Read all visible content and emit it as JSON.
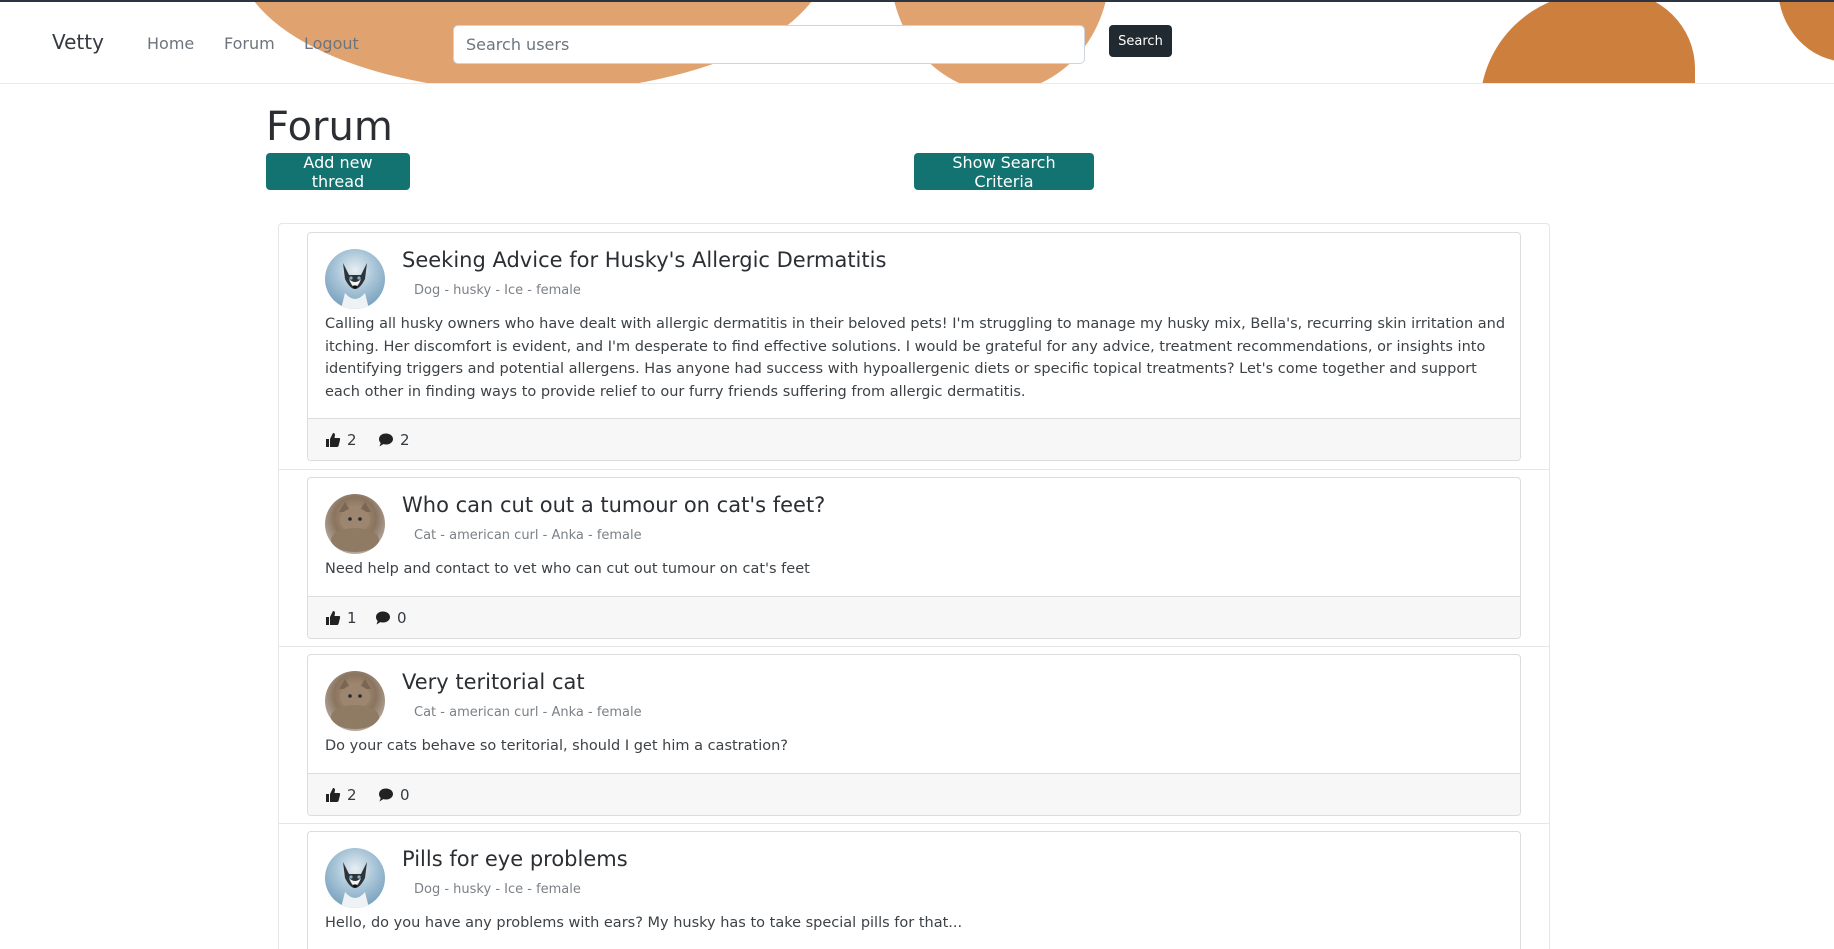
{
  "nav": {
    "brand": "Vetty",
    "home": "Home",
    "forum": "Forum",
    "logout": "Logout",
    "search_placeholder": "Search users",
    "search_button": "Search"
  },
  "page": {
    "title": "Forum",
    "add_thread_button": "Add new thread",
    "show_criteria_button": "Show Search Criteria"
  },
  "threads": [
    {
      "title": "Seeking Advice for Husky's Allergic Dermatitis",
      "pet_info": "Dog - husky - Ice - female",
      "content": "Calling all husky owners who have dealt with allergic dermatitis in their beloved pets! I'm struggling to manage my husky mix, Bella's, recurring skin irritation and itching. Her discomfort is evident, and I'm desperate to find effective solutions. I would be grateful for any advice, treatment recommendations, or insights into identifying triggers and potential allergens. Has anyone had success with hypoallergenic diets or specific topical treatments? Let's come together and support each other in finding ways to provide relief to our furry friends suffering from allergic dermatitis.",
      "likes": "2",
      "comments": "2",
      "avatar": "husky-avatar"
    },
    {
      "title": "Who can cut out a tumour on cat's feet?",
      "pet_info": "Cat - american curl - Anka - female",
      "content": "Need help and contact to vet who can cut out tumour on cat's feet",
      "likes": "1",
      "comments": "0",
      "avatar": "cat-avatar"
    },
    {
      "title": "Very teritorial cat",
      "pet_info": "Cat - american curl - Anka - female",
      "content": "Do your cats behave so teritorial, should I get him a castration?",
      "likes": "2",
      "comments": "0",
      "avatar": "cat-avatar"
    },
    {
      "title": "Pills for eye problems",
      "pet_info": "Dog - husky - Ice - female",
      "content": "Hello, do you have any problems with ears? My husky has to take special pills for that...",
      "likes": "",
      "comments": "",
      "avatar": "husky-avatar"
    }
  ],
  "colors": {
    "accent_teal": "#137371",
    "blob_light": "#e0a370",
    "blob_dark": "#cd7f3e",
    "search_button": "#222a31"
  }
}
